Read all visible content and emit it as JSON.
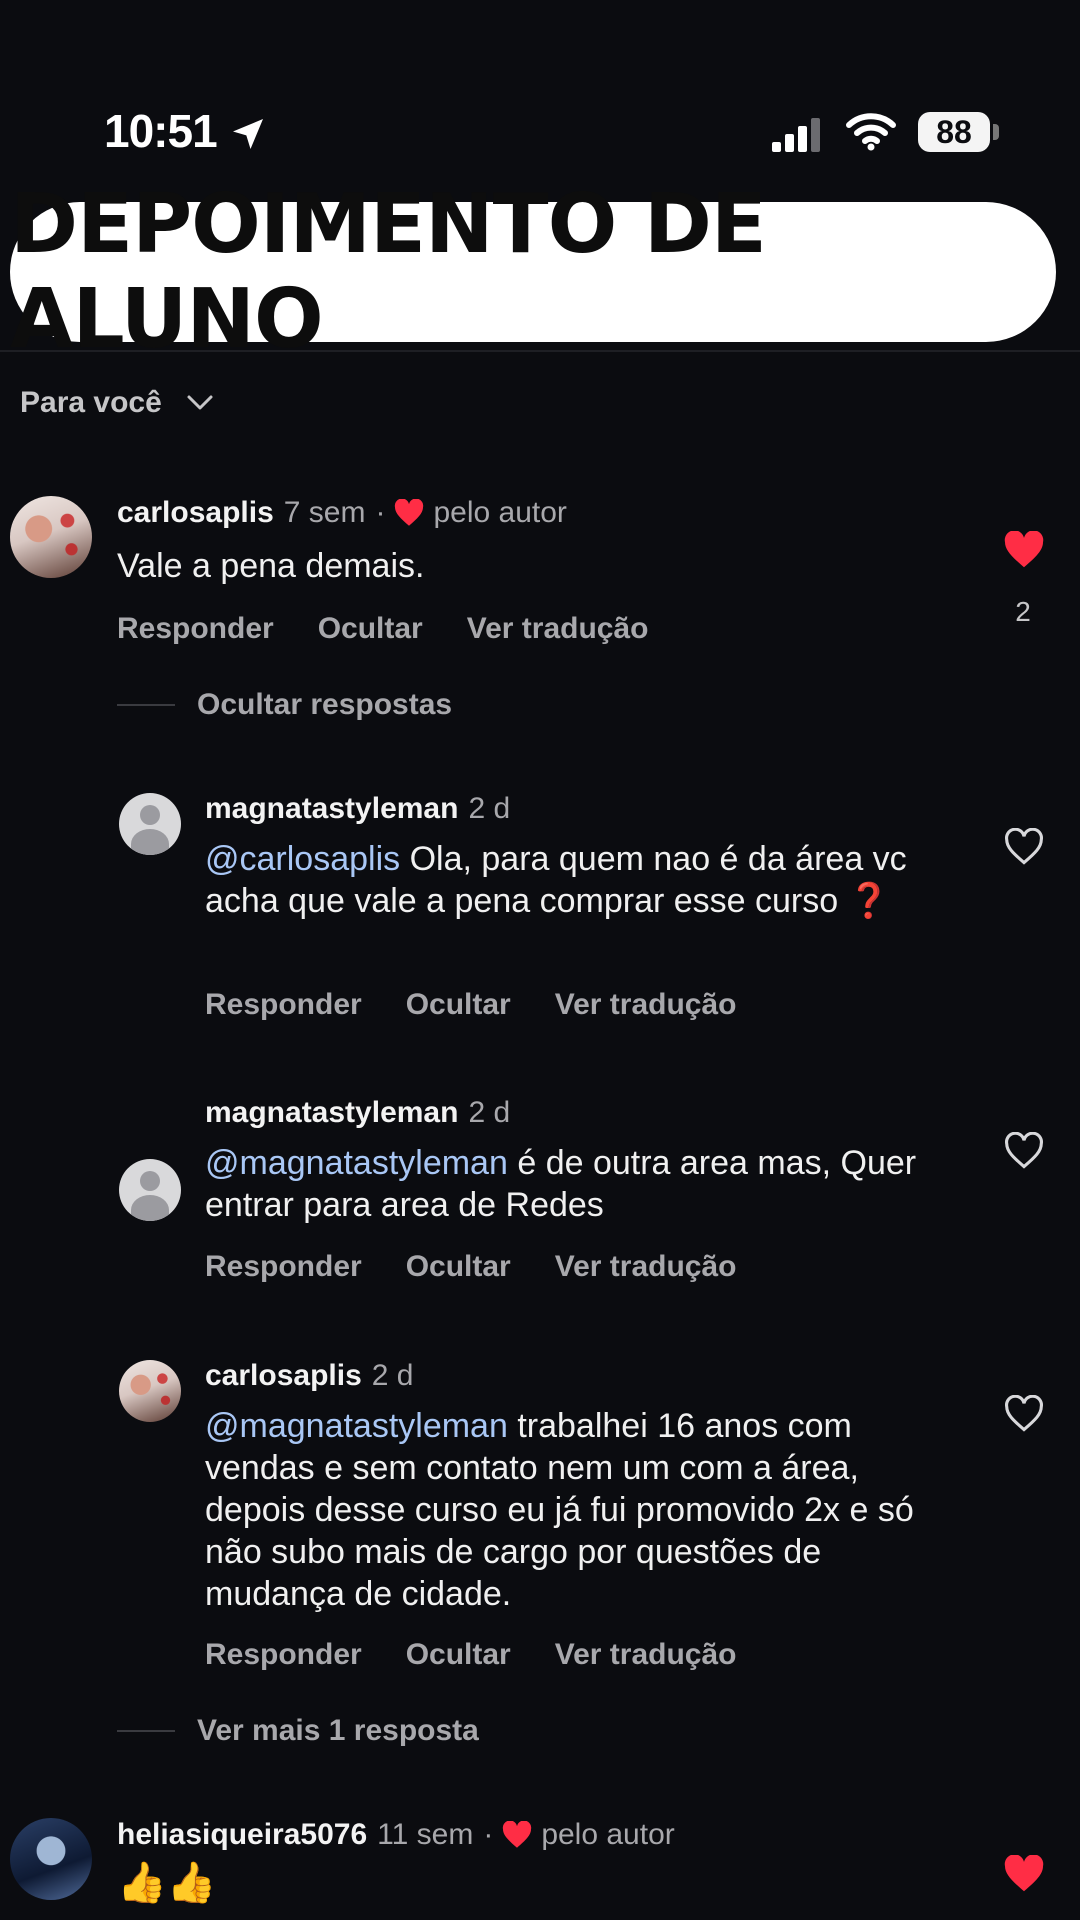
{
  "status_bar": {
    "time": "10:51",
    "battery": "88"
  },
  "banner": {
    "title": "DEPOIMENTO DE ALUNO"
  },
  "feed": {
    "sort_label": "Para você"
  },
  "comments": [
    {
      "username": "carlosaplis",
      "time": "7 sem",
      "separator": "·",
      "author_like": "pelo autor",
      "text": "Vale a pena demais.",
      "liked": true,
      "like_count": "2",
      "actions": [
        "Responder",
        "Ocultar",
        "Ver tradução"
      ],
      "replies_toggle": "Ocultar respostas",
      "replies": [
        {
          "username": "magnatastyleman",
          "time": "2 d",
          "mention": "@carlosaplis",
          "text": " Ola, para quem nao é  da área vc acha que vale a pena comprar esse curso ",
          "emoji": "❓",
          "liked": false,
          "actions": [
            "Responder",
            "Ocultar",
            "Ver tradução"
          ]
        },
        {
          "username": "magnatastyleman",
          "time": "2 d",
          "mention": "@magnatastyleman",
          "text": "  é  de outra area mas, Quer entrar para area de Redes",
          "liked": false,
          "actions": [
            "Responder",
            "Ocultar",
            "Ver tradução"
          ]
        },
        {
          "username": "carlosaplis",
          "time": "2 d",
          "mention": "@magnatastyleman",
          "text": " trabalhei 16 anos com vendas e sem contato nem um com a área, depois desse curso eu já fui promovido 2x e só não subo mais de cargo por questões de mudança de cidade.",
          "liked": false,
          "actions": [
            "Responder",
            "Ocultar",
            "Ver tradução"
          ]
        }
      ],
      "more_replies": "Ver mais 1 resposta"
    },
    {
      "username": "heliasiqueira5076",
      "time": "11 sem",
      "separator": "·",
      "author_like": "pelo autor",
      "text": "👍👍",
      "liked": true
    }
  ],
  "colors": {
    "like": "#ff2d45",
    "mention": "#a9c7f5",
    "background": "#0b0c10"
  }
}
